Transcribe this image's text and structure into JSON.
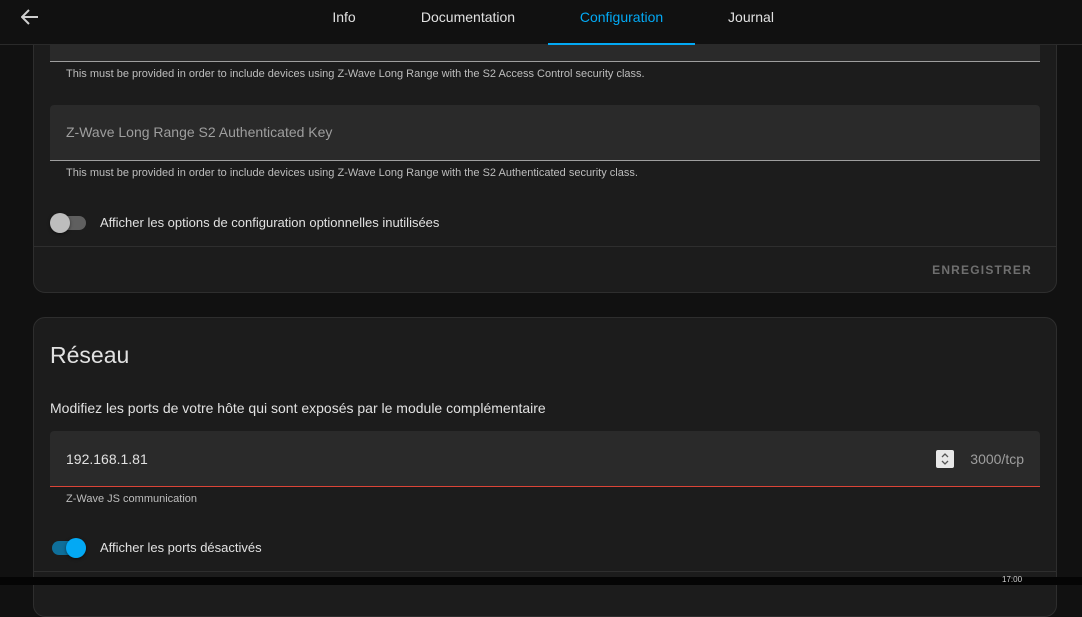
{
  "header": {
    "back_icon": "arrow-left-icon",
    "tabs": [
      {
        "label": "Info",
        "active": false
      },
      {
        "label": "Documentation",
        "active": false
      },
      {
        "label": "Configuration",
        "active": true
      },
      {
        "label": "Journal",
        "active": false
      }
    ],
    "accent": "#03a9f4"
  },
  "config_card": {
    "access_control_helper": "This must be provided in order to include devices using Z-Wave Long Range with the S2 Access Control security class.",
    "auth_key_field": {
      "label": "Z-Wave Long Range S2 Authenticated Key",
      "value": ""
    },
    "auth_key_helper": "This must be provided in order to include devices using Z-Wave Long Range with the S2 Authenticated security class.",
    "show_unused_toggle": {
      "label": "Afficher les options de configuration optionnelles inutilisées",
      "checked": false
    },
    "save_label": "ENREGISTRER"
  },
  "network_card": {
    "title": "Réseau",
    "description": "Modifiez les ports de votre hôte qui sont exposés par le module complémentaire",
    "port_field": {
      "value": "192.168.1.81",
      "suffix": "3000/tcp",
      "helper": "Z-Wave JS communication"
    },
    "show_disabled_toggle": {
      "label": "Afficher les ports désactivés",
      "checked": true
    }
  },
  "taskbar": {
    "clock": "17:00"
  }
}
